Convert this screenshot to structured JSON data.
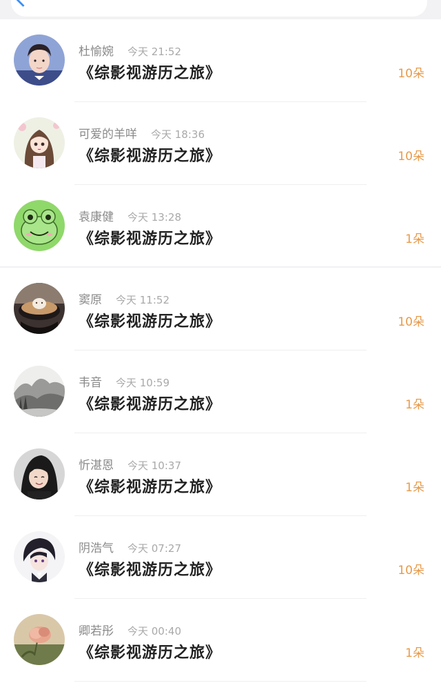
{
  "header": {
    "back_icon": "chevron-left-icon",
    "accent": "#3b8ff3"
  },
  "colors": {
    "gift": "#e79a4a",
    "name": "#8a8a8a",
    "time": "#a9a9a9"
  },
  "items": [
    {
      "name": "杜愉婉",
      "time": "今天 21:52",
      "book": "《综影视游历之旅》",
      "gift": "10朵",
      "avatar": "person-avatar"
    },
    {
      "name": "可爱的羊咩",
      "time": "今天 18:36",
      "book": "《综影视游历之旅》",
      "gift": "10朵",
      "avatar": "anime-girl-avatar"
    },
    {
      "name": "袁康健",
      "time": "今天 13:28",
      "book": "《综影视游历之旅》",
      "gift": "1朵",
      "avatar": "frog-avatar"
    },
    {
      "name": "窦原",
      "time": "今天 11:52",
      "book": "《综影视游历之旅》",
      "gift": "10朵",
      "avatar": "latte-art-avatar"
    },
    {
      "name": "韦音",
      "time": "今天 10:59",
      "book": "《综影视游历之旅》",
      "gift": "1朵",
      "avatar": "landscape-painting-avatar"
    },
    {
      "name": "忻湛恩",
      "time": "今天 10:37",
      "book": "《综影视游历之旅》",
      "gift": "1朵",
      "avatar": "person-avatar"
    },
    {
      "name": "阴浩气",
      "time": "今天 07:27",
      "book": "《综影视游历之旅》",
      "gift": "10朵",
      "avatar": "anime-boy-avatar"
    },
    {
      "name": "卿若彤",
      "time": "今天 00:40",
      "book": "《综影视游历之旅》",
      "gift": "1朵",
      "avatar": "flower-avatar"
    }
  ]
}
